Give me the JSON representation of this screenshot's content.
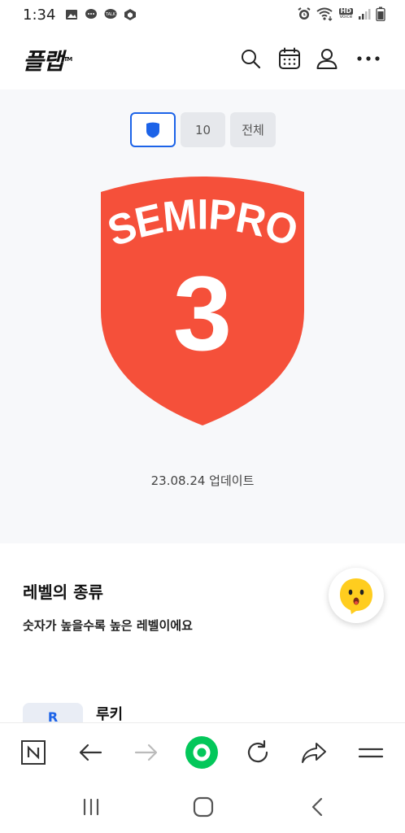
{
  "status_bar": {
    "time": "1:34",
    "left_icons": [
      "gallery-icon",
      "message-icon",
      "talk-icon",
      "cube-icon"
    ],
    "right_icons": [
      "alarm-icon",
      "wifi-icon",
      "hd-voice-icon",
      "signal-icon",
      "battery-icon"
    ],
    "hd_label": "HD",
    "voice_label": "Voice"
  },
  "header": {
    "logo": "플랩",
    "logo_tm": "TM",
    "icons": [
      "search-icon",
      "calendar-icon",
      "profile-icon",
      "more-icon"
    ]
  },
  "level": {
    "tabs": [
      {
        "label": "",
        "icon": "shield-icon",
        "selected": true
      },
      {
        "label": "10",
        "selected": false
      },
      {
        "label": "전체",
        "selected": false
      }
    ],
    "badge": {
      "title": "SEMIPRO",
      "number": "3",
      "color": "#f5503a"
    },
    "update_text": "23.08.24 업데이트"
  },
  "level_types": {
    "title": "레벨의 종류",
    "description": "숫자가 높을수록 높은 레벨이에요",
    "items": [
      {
        "badge": "R",
        "name": "루키"
      }
    ]
  },
  "browser_toolbar": {
    "buttons": [
      "naver-icon",
      "back-arrow-icon",
      "forward-arrow-icon",
      "home-green-icon",
      "refresh-icon",
      "share-icon",
      "menu-icon"
    ]
  },
  "nav_bar": {
    "buttons": [
      "recent-apps-icon",
      "home-icon",
      "back-icon"
    ]
  },
  "colors": {
    "accent": "#1c63e8",
    "badge_red": "#f5503a",
    "green": "#03c75a"
  }
}
